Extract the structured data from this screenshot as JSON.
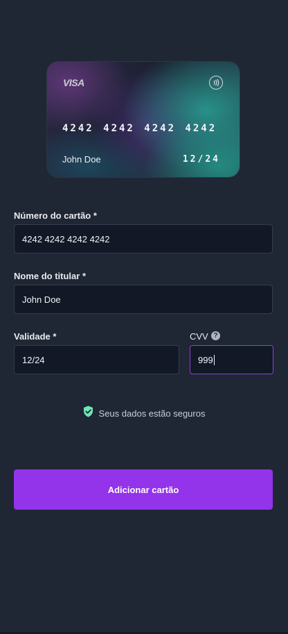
{
  "card": {
    "brand": "VISA",
    "number": "4242 4242 4242 4242",
    "holder": "John Doe",
    "expiry": "12/24"
  },
  "form": {
    "card_number": {
      "label": "Número do cartão *",
      "value": "4242 4242 4242 4242"
    },
    "holder_name": {
      "label": "Nome do titular *",
      "value": "John Doe"
    },
    "expiry": {
      "label": "Validade *",
      "value": "12/24"
    },
    "cvv": {
      "label": "CVV",
      "value": "999",
      "help_icon": "question-circle-icon"
    }
  },
  "security_note": {
    "text": "Seus dados estão seguros",
    "icon": "shield-check-icon",
    "color": "#6ee7b7"
  },
  "submit": {
    "label": "Adicionar cartão",
    "color": "#9333ea"
  },
  "theme": {
    "background": "#1f2634",
    "input_background": "#121826",
    "focus_border": "#8a44d9"
  }
}
